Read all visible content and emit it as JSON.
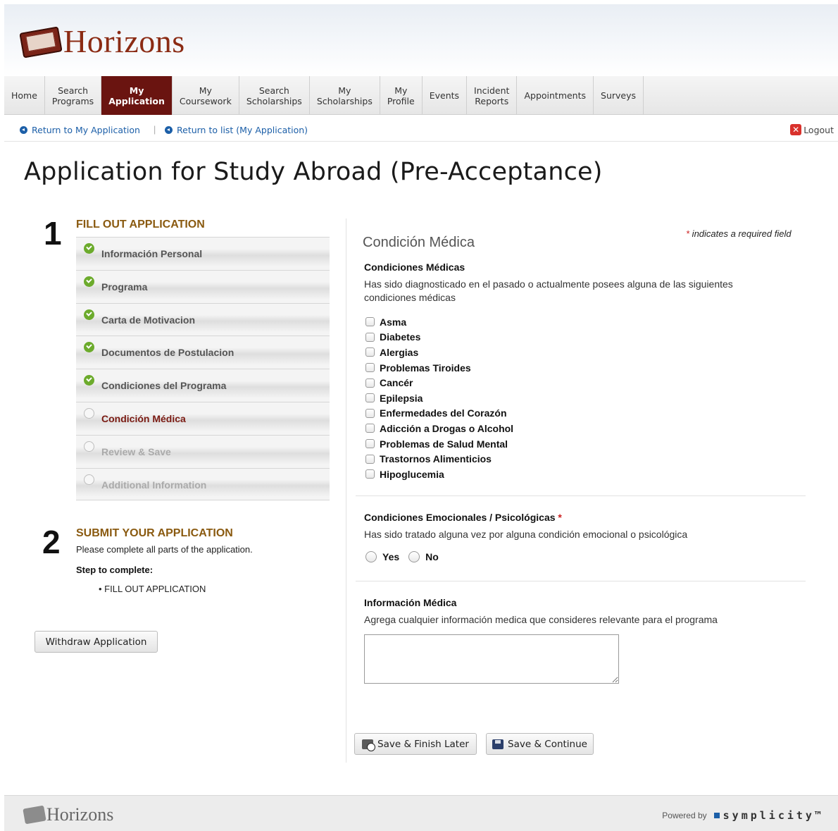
{
  "brand": {
    "name": "Horizons"
  },
  "nav": {
    "items": [
      {
        "label": "Home",
        "active": false
      },
      {
        "label": "Search\nPrograms",
        "active": false
      },
      {
        "label": "My\nApplication",
        "active": true
      },
      {
        "label": "My\nCoursework",
        "active": false
      },
      {
        "label": "Search\nScholarships",
        "active": false
      },
      {
        "label": "My\nScholarships",
        "active": false
      },
      {
        "label": "My\nProfile",
        "active": false
      },
      {
        "label": "Events",
        "active": false
      },
      {
        "label": "Incident\nReports",
        "active": false
      },
      {
        "label": "Appointments",
        "active": false
      },
      {
        "label": "Surveys",
        "active": false
      }
    ]
  },
  "subbar": {
    "return_app": "Return to My Application",
    "separator": "|",
    "return_list": "Return to list (My Application)",
    "logout": "Logout"
  },
  "page_title": "Application for Study Abroad (Pre-Acceptance)",
  "steps_panel": {
    "step1_number": "1",
    "step1_title": "FILL OUT APPLICATION",
    "steps": [
      {
        "label": "Información Personal",
        "status": "done"
      },
      {
        "label": "Programa",
        "status": "done"
      },
      {
        "label": "Carta de Motivacion",
        "status": "done"
      },
      {
        "label": "Documentos de Postulacion",
        "status": "done"
      },
      {
        "label": "Condiciones del Programa",
        "status": "done"
      },
      {
        "label": "Condición Médica",
        "status": "current"
      },
      {
        "label": "Review & Save",
        "status": "disabled"
      },
      {
        "label": "Additional Information",
        "status": "disabled"
      }
    ],
    "step2_number": "2",
    "step2_title": "SUBMIT YOUR APPLICATION",
    "step2_note": "Please complete all parts of the application.",
    "step_to_complete": "Step to complete:",
    "step_to_complete_item": "• FILL OUT APPLICATION",
    "withdraw_label": "Withdraw Application"
  },
  "form": {
    "required_star": "*",
    "required_note": " indicates a required field",
    "section_title": "Condición Médica",
    "medical": {
      "label": "Condiciones Médicas",
      "description": "Has sido diagnosticado en el pasado o actualmente posees alguna de las siguientes condiciones médicas",
      "options": [
        "Asma",
        "Diabetes",
        "Alergias",
        "Problemas Tiroides",
        "Cancér",
        "Epilepsia",
        "Enfermedades del Corazón",
        "Adicción a Drogas o Alcohol",
        "Problemas de Salud Mental",
        "Trastornos Alimenticios",
        "Hipoglucemia"
      ]
    },
    "emotional": {
      "label": "Condiciones Emocionales / Psicológicas",
      "star": "*",
      "description": "Has sido tratado alguna vez por alguna condición emocional o psicológica",
      "yes": "Yes",
      "no": "No"
    },
    "info": {
      "label": "Información Médica",
      "description": "Agrega cualquier información medica que consideres relevante para el programa",
      "value": ""
    },
    "save_later": "Save & Finish Later",
    "save_continue": "Save & Continue"
  },
  "footer": {
    "brand": "Horizons",
    "powered_by": "Powered by",
    "vendor": "symplicity™"
  },
  "colors": {
    "brand": "#8b2b14",
    "nav_active": "#6a1410",
    "link": "#1c5fa8",
    "step_heading": "#8a5a10",
    "done": "#6cab2c"
  }
}
